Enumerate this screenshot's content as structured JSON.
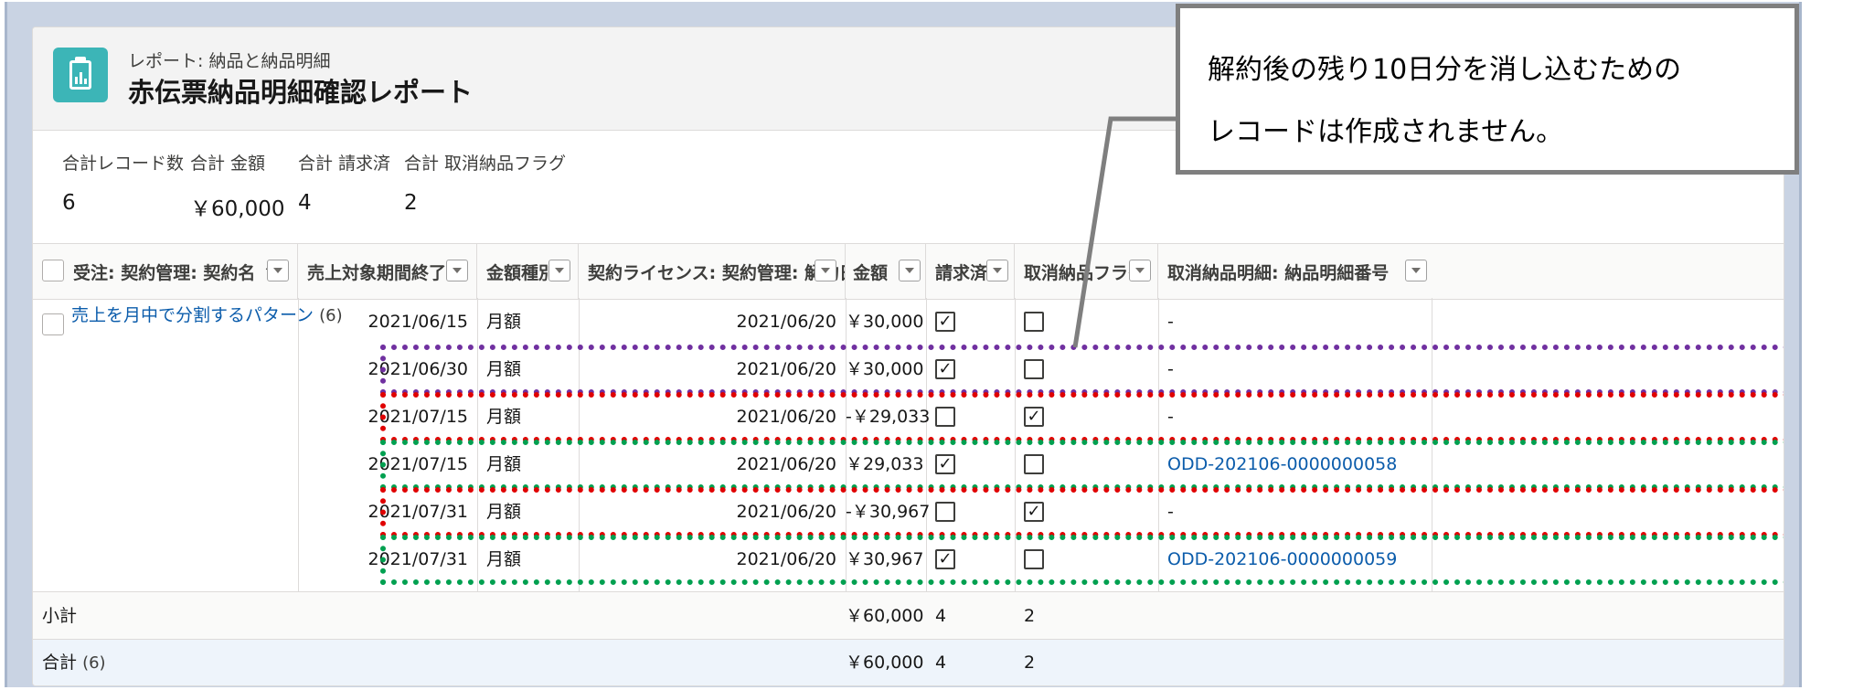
{
  "header": {
    "subtitle": "レポート: 納品と納品明細",
    "title": "赤伝票納品明細確認レポート"
  },
  "summary": [
    {
      "label": "合計レコード数",
      "value": "6"
    },
    {
      "label": "合計 金額",
      "value": "￥60,000"
    },
    {
      "label": "合計 請求済",
      "value": "4"
    },
    {
      "label": "合計 取消納品フラグ",
      "value": "2"
    }
  ],
  "columns": [
    {
      "label": "受注: 契約管理: 契約名",
      "sort": "↑"
    },
    {
      "label": "売上対象期間終了",
      "sort": "↑"
    },
    {
      "label": "金額種別"
    },
    {
      "label": "契約ライセンス: 契約管理: 解約日"
    },
    {
      "label": "金額"
    },
    {
      "label": "請求済"
    },
    {
      "label": "取消納品フラグ"
    },
    {
      "label": "取消納品明細: 納品明細番号"
    }
  ],
  "group": {
    "name": "売上を月中で分割するパターン",
    "count": "(6)"
  },
  "rows": [
    {
      "end": "2021/06/15",
      "type": "月額",
      "cancel_date": "2021/06/20",
      "amount": "￥30,000",
      "billed": true,
      "cancel_flag": false,
      "detail_no": "-"
    },
    {
      "end": "2021/06/30",
      "type": "月額",
      "cancel_date": "2021/06/20",
      "amount": "￥30,000",
      "billed": true,
      "cancel_flag": false,
      "detail_no": "-"
    },
    {
      "end": "2021/07/15",
      "type": "月額",
      "cancel_date": "2021/06/20",
      "amount": "-￥29,033",
      "billed": false,
      "cancel_flag": true,
      "detail_no": "-"
    },
    {
      "end": "2021/07/15",
      "type": "月額",
      "cancel_date": "2021/06/20",
      "amount": "￥29,033",
      "billed": true,
      "cancel_flag": false,
      "detail_no": "ODD-202106-0000000058"
    },
    {
      "end": "2021/07/31",
      "type": "月額",
      "cancel_date": "2021/06/20",
      "amount": "-￥30,967",
      "billed": false,
      "cancel_flag": true,
      "detail_no": "-"
    },
    {
      "end": "2021/07/31",
      "type": "月額",
      "cancel_date": "2021/06/20",
      "amount": "￥30,967",
      "billed": true,
      "cancel_flag": false,
      "detail_no": "ODD-202106-0000000059"
    }
  ],
  "subtotal": {
    "label": "小計",
    "amount": "￥60,000",
    "billed": "4",
    "cancel_flag": "2"
  },
  "total": {
    "label": "合計",
    "count": "(6)",
    "amount": "￥60,000",
    "billed": "4",
    "cancel_flag": "2"
  },
  "callout": {
    "line1": "解約後の残り10日分を消し込むための",
    "line2": "レコードは作成されません。"
  },
  "colors": {
    "purple": "#7030a0",
    "red": "#e00000",
    "green": "#00a050",
    "link": "#0b5cab",
    "icon": "#3cb5b7"
  },
  "check_glyph": "✓"
}
